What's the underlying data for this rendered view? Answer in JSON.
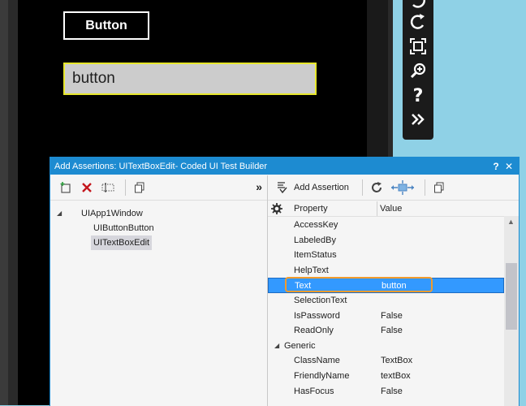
{
  "emulator": {
    "app_button_label": "Button",
    "app_textbox_value": "button"
  },
  "dialog": {
    "title": "Add Assertions: UITextBoxEdit- Coded UI Test Builder",
    "help_button": "?",
    "close_button": "✕"
  },
  "left_toolbar": {
    "more_label": "»"
  },
  "tree": {
    "root": "UIApp1Window",
    "children": [
      "UIButtonButton",
      "UITextBoxEdit"
    ]
  },
  "right_toolbar": {
    "add_assertion_label": "Add Assertion"
  },
  "grid": {
    "col_property": "Property",
    "col_value": "Value",
    "rows": [
      {
        "name": "AccessKey",
        "value": ""
      },
      {
        "name": "LabeledBy",
        "value": ""
      },
      {
        "name": "ItemStatus",
        "value": ""
      },
      {
        "name": "HelpText",
        "value": ""
      },
      {
        "name": "Text",
        "value": "button"
      },
      {
        "name": "SelectionText",
        "value": ""
      },
      {
        "name": "IsPassword",
        "value": "False"
      },
      {
        "name": "ReadOnly",
        "value": "False"
      }
    ],
    "category": "Generic",
    "generic_rows": [
      {
        "name": "ClassName",
        "value": "TextBox"
      },
      {
        "name": "FriendlyName",
        "value": "textBox"
      },
      {
        "name": "HasFocus",
        "value": "False"
      }
    ]
  },
  "colors": {
    "accent": "#1d8bd1",
    "selection": "#3399ff",
    "highlight": "#f19b2c"
  }
}
